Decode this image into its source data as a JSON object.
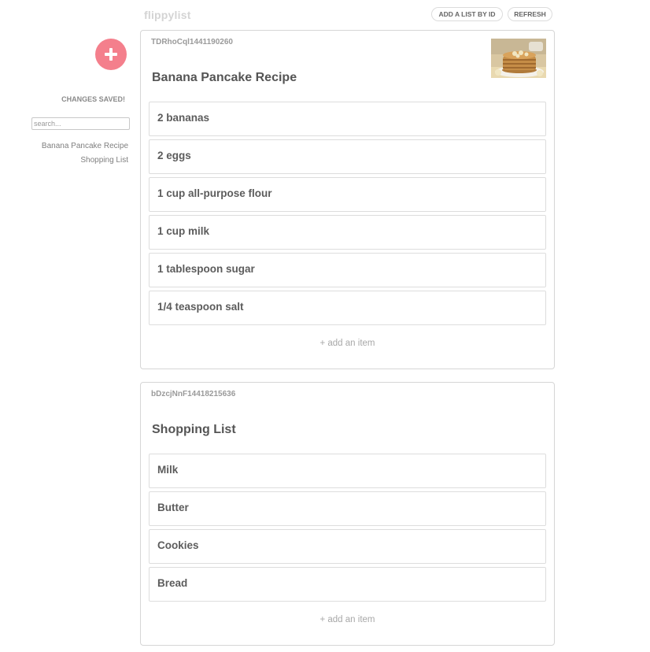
{
  "app": {
    "logo": "flippylist"
  },
  "toolbar": {
    "add_by_id_label": "ADD A LIST BY ID",
    "refresh_label": "REFRESH"
  },
  "sidebar": {
    "status": "CHANGES SAVED!",
    "search_placeholder": "search...",
    "links": [
      {
        "label": "Banana Pancake Recipe"
      },
      {
        "label": "Shopping List"
      }
    ]
  },
  "lists": [
    {
      "id": "TDRhoCql1441190260",
      "title": "Banana Pancake Recipe",
      "has_image": true,
      "items": [
        "2 bananas",
        "2 eggs",
        "1 cup all-purpose flour",
        "1 cup milk",
        "1 tablespoon sugar",
        "1/4 teaspoon salt"
      ],
      "add_item_label": "+ add an item"
    },
    {
      "id": "bDzcjNnF14418215636",
      "title": "Shopping List",
      "has_image": false,
      "items": [
        "Milk",
        "Butter",
        "Cookies",
        "Bread"
      ],
      "add_item_label": "+ add an item"
    }
  ],
  "colors": {
    "accent": "#f47f8c",
    "logo": "#d4d4d4",
    "border": "#d6d6d6",
    "text": "#5a5a5a"
  },
  "icons": {
    "add_list": "plus-icon"
  }
}
